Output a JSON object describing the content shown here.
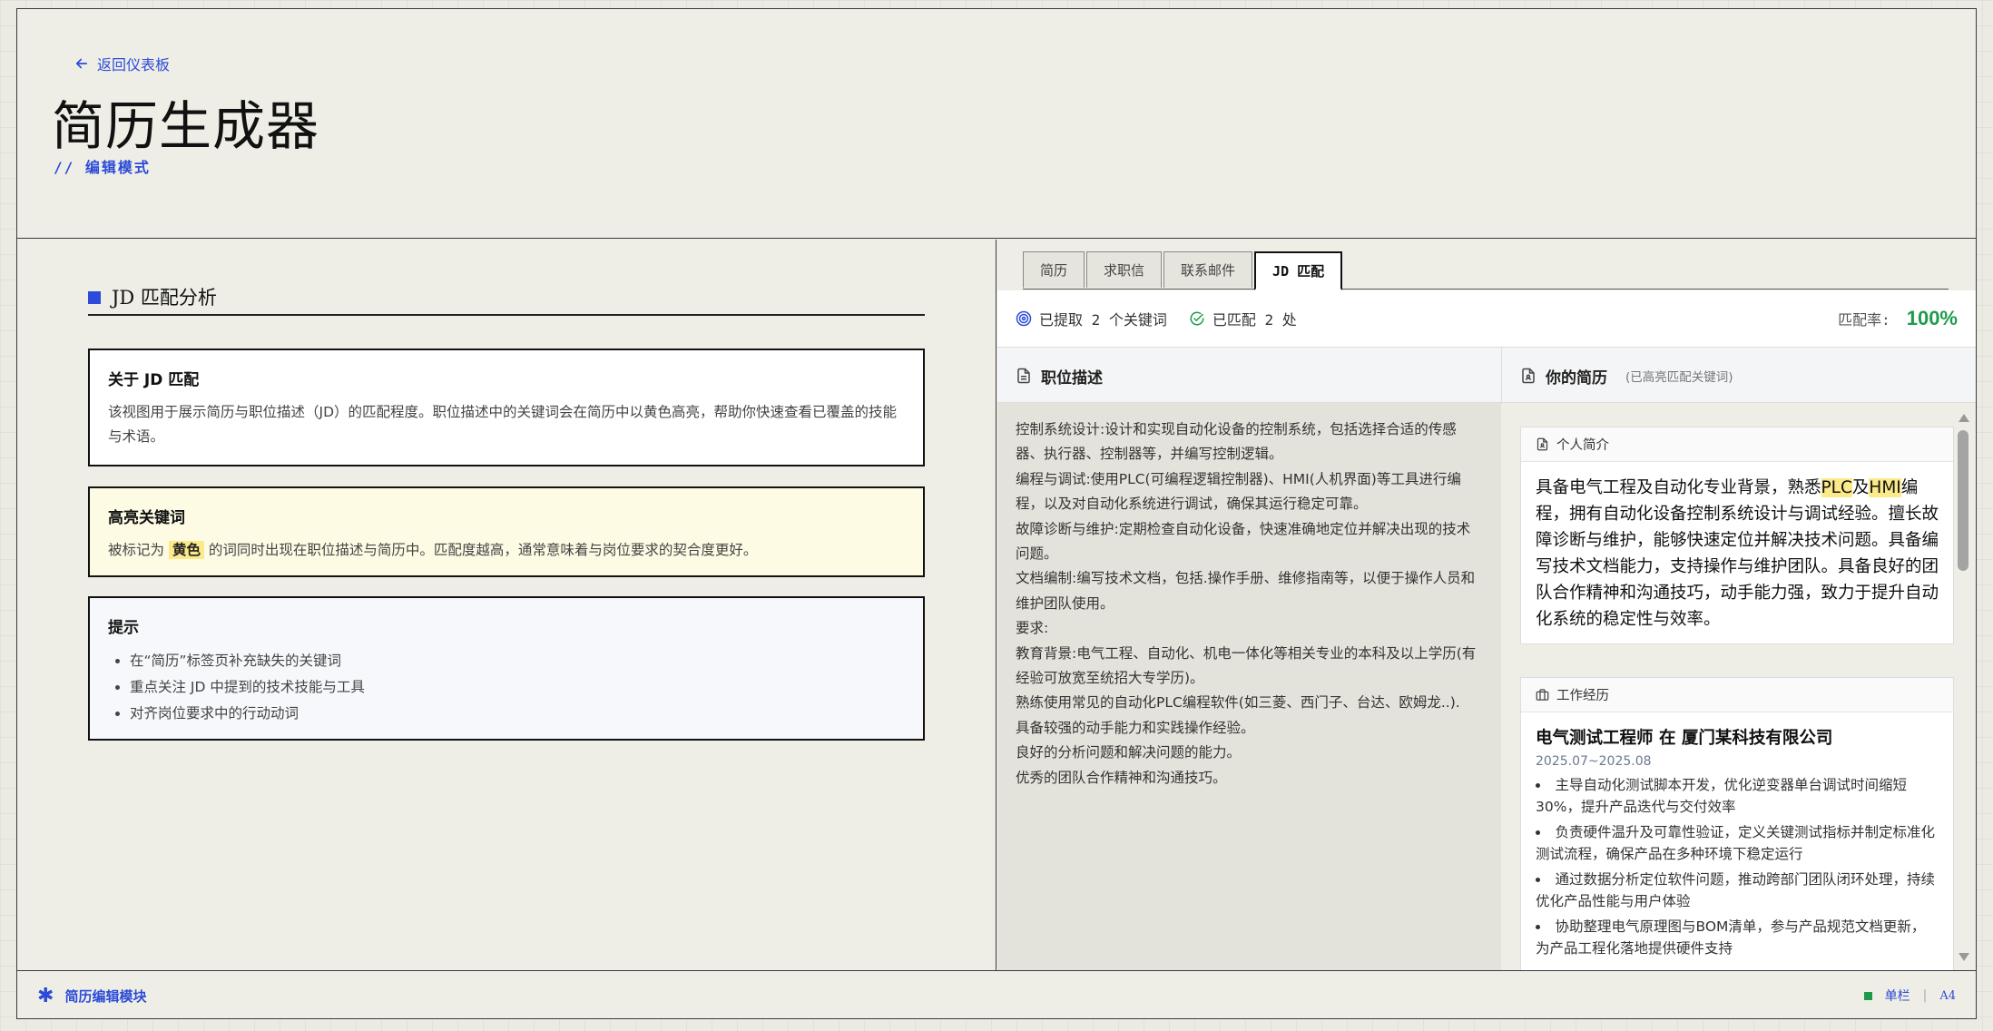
{
  "header": {
    "back_label": "返回仪表板",
    "title": "简历生成器",
    "subtitle": "// 编辑模式"
  },
  "left": {
    "section_title": "JD 匹配分析",
    "about": {
      "title": "关于 JD 匹配",
      "body": "该视图用于展示简历与职位描述（JD）的匹配程度。职位描述中的关键词会在简历中以黄色高亮，帮助你快速查看已覆盖的技能与术语。"
    },
    "highlight": {
      "title": "高亮关键词",
      "prefix": "被标记为",
      "tag": "黄色",
      "suffix": "的词同时出现在职位描述与简历中。匹配度越高，通常意味着与岗位要求的契合度更好。"
    },
    "tips": {
      "title": "提示",
      "items": [
        "在“简历”标签页补充缺失的关键词",
        "重点关注 JD 中提到的技术技能与工具",
        "对齐岗位要求中的行动动词"
      ]
    }
  },
  "tabs": [
    "简历",
    "求职信",
    "联系邮件",
    "JD 匹配"
  ],
  "active_tab": "JD 匹配",
  "stats": {
    "extracted": "已提取 2 个关键词",
    "matched": "已匹配 2 处",
    "match_label": "匹配率:",
    "match_rate": "100%"
  },
  "jd": {
    "heading": "职位描述",
    "lines": [
      "控制系统设计:设计和实现自动化设备的控制系统，包括选择合适的传感器、执行器、控制器等，并编写控制逻辑。",
      "编程与调试:使用PLC(可编程逻辑控制器)、HMI(人机界面)等工具进行编程，以及对自动化系统进行调试，确保其运行稳定可靠。",
      "故障诊断与维护:定期检查自动化设备，快速准确地定位并解决出现的技术问题。",
      "文档编制:编写技术文档，包括.操作手册、维修指南等，以便于操作人员和维护团队使用。",
      "要求:",
      "教育背景:电气工程、自动化、机电一体化等相关专业的本科及以上学历(有经验可放宽至统招大专学历)。",
      "熟练使用常见的自动化PLC编程软件(如三菱、西门子、台达、欧姆龙..).",
      "具备较强的动手能力和实践操作经验。",
      "良好的分析问题和解决问题的能力。",
      "优秀的团队合作精神和沟通技巧。"
    ]
  },
  "resume": {
    "heading": "你的简历",
    "note": "(已高亮匹配关键词)",
    "summary": {
      "title": "个人简介",
      "p1": "具备电气工程及自动化专业背景，熟悉",
      "kw1": "PLC",
      "p2": "及",
      "kw2": "HMI",
      "p3": "编程，拥有自动化设备控制系统设计与调试经验。擅长故障诊断与维护，能够快速定位并解决技术问题。具备编写技术文档能力，支持操作与维护团队。具备良好的团队合作精神和沟通技巧，动手能力强，致力于提升自动化系统的稳定性与效率。"
    },
    "experience": {
      "title": "工作经历",
      "job_title": "电气测试工程师 在 厦门某科技有限公司",
      "date": "2025.07~2025.08",
      "bullets": [
        "主导自动化测试脚本开发，优化逆变器单台调试时间缩短30%，提升产品迭代与交付效率",
        "负责硬件温升及可靠性验证，定义关键测试指标并制定标准化测试流程，确保产品在多种环境下稳定运行",
        "通过数据分析定位软件问题，推动跨部门团队闭环处理，持续优化产品性能与用户体验",
        "协助整理电气原理图与BOM清单，参与产品规范文档更新，为产品工程化落地提供硬件支持"
      ]
    }
  },
  "footer": {
    "left_label": "简历编辑模块",
    "layout": "单栏",
    "paper": "A4"
  },
  "colors": {
    "accent": "#2b4bd8",
    "highlight": "#fbe98a",
    "success": "#1e9b4a"
  }
}
